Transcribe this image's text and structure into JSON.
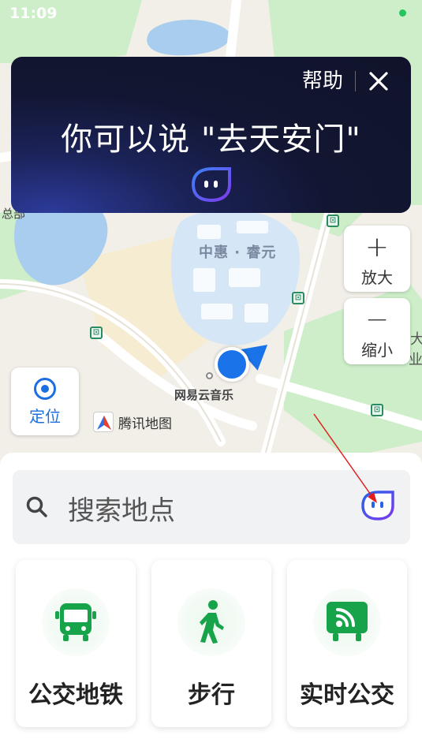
{
  "status_bar": {
    "time": "11:09"
  },
  "voice_banner": {
    "help_label": "帮助",
    "hint_text": "你可以说 \"去天安门\"",
    "close_icon": "close-icon",
    "assistant_icon": "voice-assistant-icon"
  },
  "map": {
    "labels": {
      "left_edge": "总部",
      "place_name": "中惠 · 睿元",
      "poi_name": "网易云音乐",
      "right_edge_top": "大",
      "right_edge_bottom": "业"
    },
    "zoom_in": {
      "symbol": "+",
      "label": "放大"
    },
    "zoom_out": {
      "symbol": "−",
      "label": "缩小"
    },
    "locate": {
      "label": "定位",
      "icon": "locate-icon"
    },
    "provider_logo": {
      "label": "腾讯地图"
    }
  },
  "panel": {
    "search": {
      "placeholder": "搜索地点",
      "icon": "search-icon",
      "assistant_icon": "voice-assistant-icon"
    },
    "cards": [
      {
        "label": "公交地铁",
        "icon": "bus-icon"
      },
      {
        "label": "步行",
        "icon": "walking-icon"
      },
      {
        "label": "实时公交",
        "icon": "realtime-bus-icon"
      }
    ]
  },
  "colors": {
    "accent_blue": "#1b6fe0",
    "transit_green": "#16a34a",
    "banner_dark": "#10132a",
    "annotation_red": "#e11d1d"
  }
}
